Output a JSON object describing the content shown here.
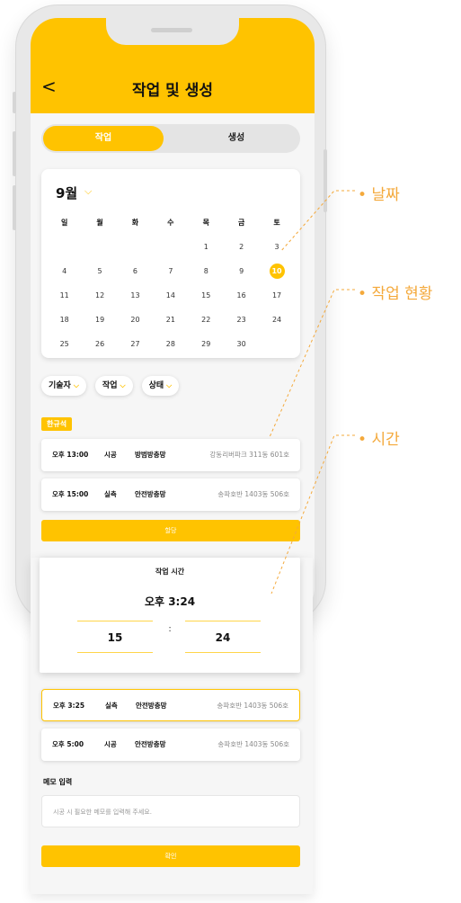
{
  "header": {
    "back_icon": "chevron-left-icon",
    "back_glyph": "<",
    "title": "작업 및 생성"
  },
  "toggle": {
    "active_label": "작업",
    "inactive_label": "생성"
  },
  "calendar": {
    "month_label": "9월",
    "chevron_glyph": "⌵",
    "weekdays": [
      "일",
      "월",
      "화",
      "수",
      "목",
      "금",
      "토"
    ],
    "weeks": [
      [
        "",
        "",
        "",
        "",
        "1",
        "2",
        "3"
      ],
      [
        "4",
        "5",
        "6",
        "7",
        "8",
        "9",
        "10"
      ],
      [
        "11",
        "12",
        "13",
        "14",
        "15",
        "16",
        "17"
      ],
      [
        "18",
        "19",
        "20",
        "21",
        "22",
        "23",
        "24"
      ],
      [
        "25",
        "26",
        "27",
        "28",
        "29",
        "30",
        ""
      ]
    ],
    "selected_day": "10",
    "accent_color": "#ffc300"
  },
  "filters": [
    {
      "label": "기술자",
      "chevron": "⌵"
    },
    {
      "label": "작업",
      "chevron": "⌵"
    },
    {
      "label": "상태",
      "chevron": "⌵"
    }
  ],
  "assignee_tag": "한규석",
  "tasks_top": [
    {
      "time": "오후 13:00",
      "type": "시공",
      "name": "방범방충망",
      "address": "강동리버파크 311동 601호"
    },
    {
      "time": "오후 15:00",
      "type": "실측",
      "name": "안전방충망",
      "address": "송파호반 1403동 506호"
    }
  ],
  "assign_button": "할당",
  "time_picker": {
    "label": "작업 시간",
    "value": "오후 3:24",
    "hour": "15",
    "separator": ":",
    "minute": "24"
  },
  "tasks_bottom": [
    {
      "time": "오후 3:25",
      "type": "실측",
      "name": "안전방충망",
      "address": "송파호반 1403동 506호",
      "selected": true
    },
    {
      "time": "오후 5:00",
      "type": "시공",
      "name": "안전방충망",
      "address": "송파호반 1403동 506호",
      "selected": false
    }
  ],
  "memo": {
    "label": "메모 입력",
    "placeholder": "시공 시 필요한 메모를 입력해 주세요."
  },
  "confirm_button": "확인",
  "annotations": [
    {
      "label": "날짜",
      "bullet": "•"
    },
    {
      "label": "작업 현황",
      "bullet": "•"
    },
    {
      "label": "시간",
      "bullet": "•"
    }
  ],
  "annotation_color": "#f4a93b"
}
